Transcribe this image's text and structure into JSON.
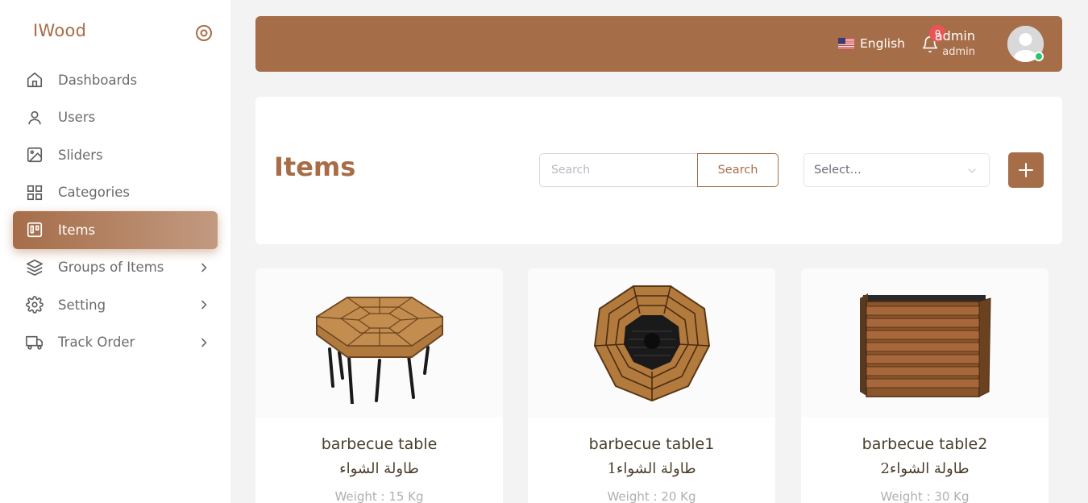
{
  "sidebar": {
    "brand": "IWood",
    "items": [
      {
        "label": "Dashboards",
        "icon": "home-icon",
        "active": false,
        "has_submenu": false
      },
      {
        "label": "Users",
        "icon": "user-icon",
        "active": false,
        "has_submenu": false
      },
      {
        "label": "Sliders",
        "icon": "image-icon",
        "active": false,
        "has_submenu": false
      },
      {
        "label": "Categories",
        "icon": "grid-icon",
        "active": false,
        "has_submenu": false
      },
      {
        "label": "Items",
        "icon": "trello-icon",
        "active": true,
        "has_submenu": false
      },
      {
        "label": "Groups of Items",
        "icon": "layers-icon",
        "active": false,
        "has_submenu": true
      },
      {
        "label": "Setting",
        "icon": "settings-icon",
        "active": false,
        "has_submenu": true
      },
      {
        "label": "Track Order",
        "icon": "truck-icon",
        "active": false,
        "has_submenu": true
      }
    ]
  },
  "header": {
    "language": "English",
    "notifications_count": "0",
    "user_name": "admin",
    "user_role": "admin"
  },
  "filters": {
    "page_title": "Items",
    "search_placeholder": "Search",
    "search_button": "Search",
    "select_placeholder": "Select..."
  },
  "items": [
    {
      "name": "barbecue table",
      "name_ar": "طاولة الشواء",
      "weight": "Weight : 15 Kg"
    },
    {
      "name": "barbecue table1",
      "name_ar": "طاولة الشواء1",
      "weight": "Weight : 20 Kg"
    },
    {
      "name": "barbecue table2",
      "name_ar": "طاولة الشواء2",
      "weight": "Weight : 30 Kg"
    }
  ],
  "colors": {
    "brand": "#a66d49",
    "badge": "#ea5455",
    "online": "#28c76f"
  }
}
